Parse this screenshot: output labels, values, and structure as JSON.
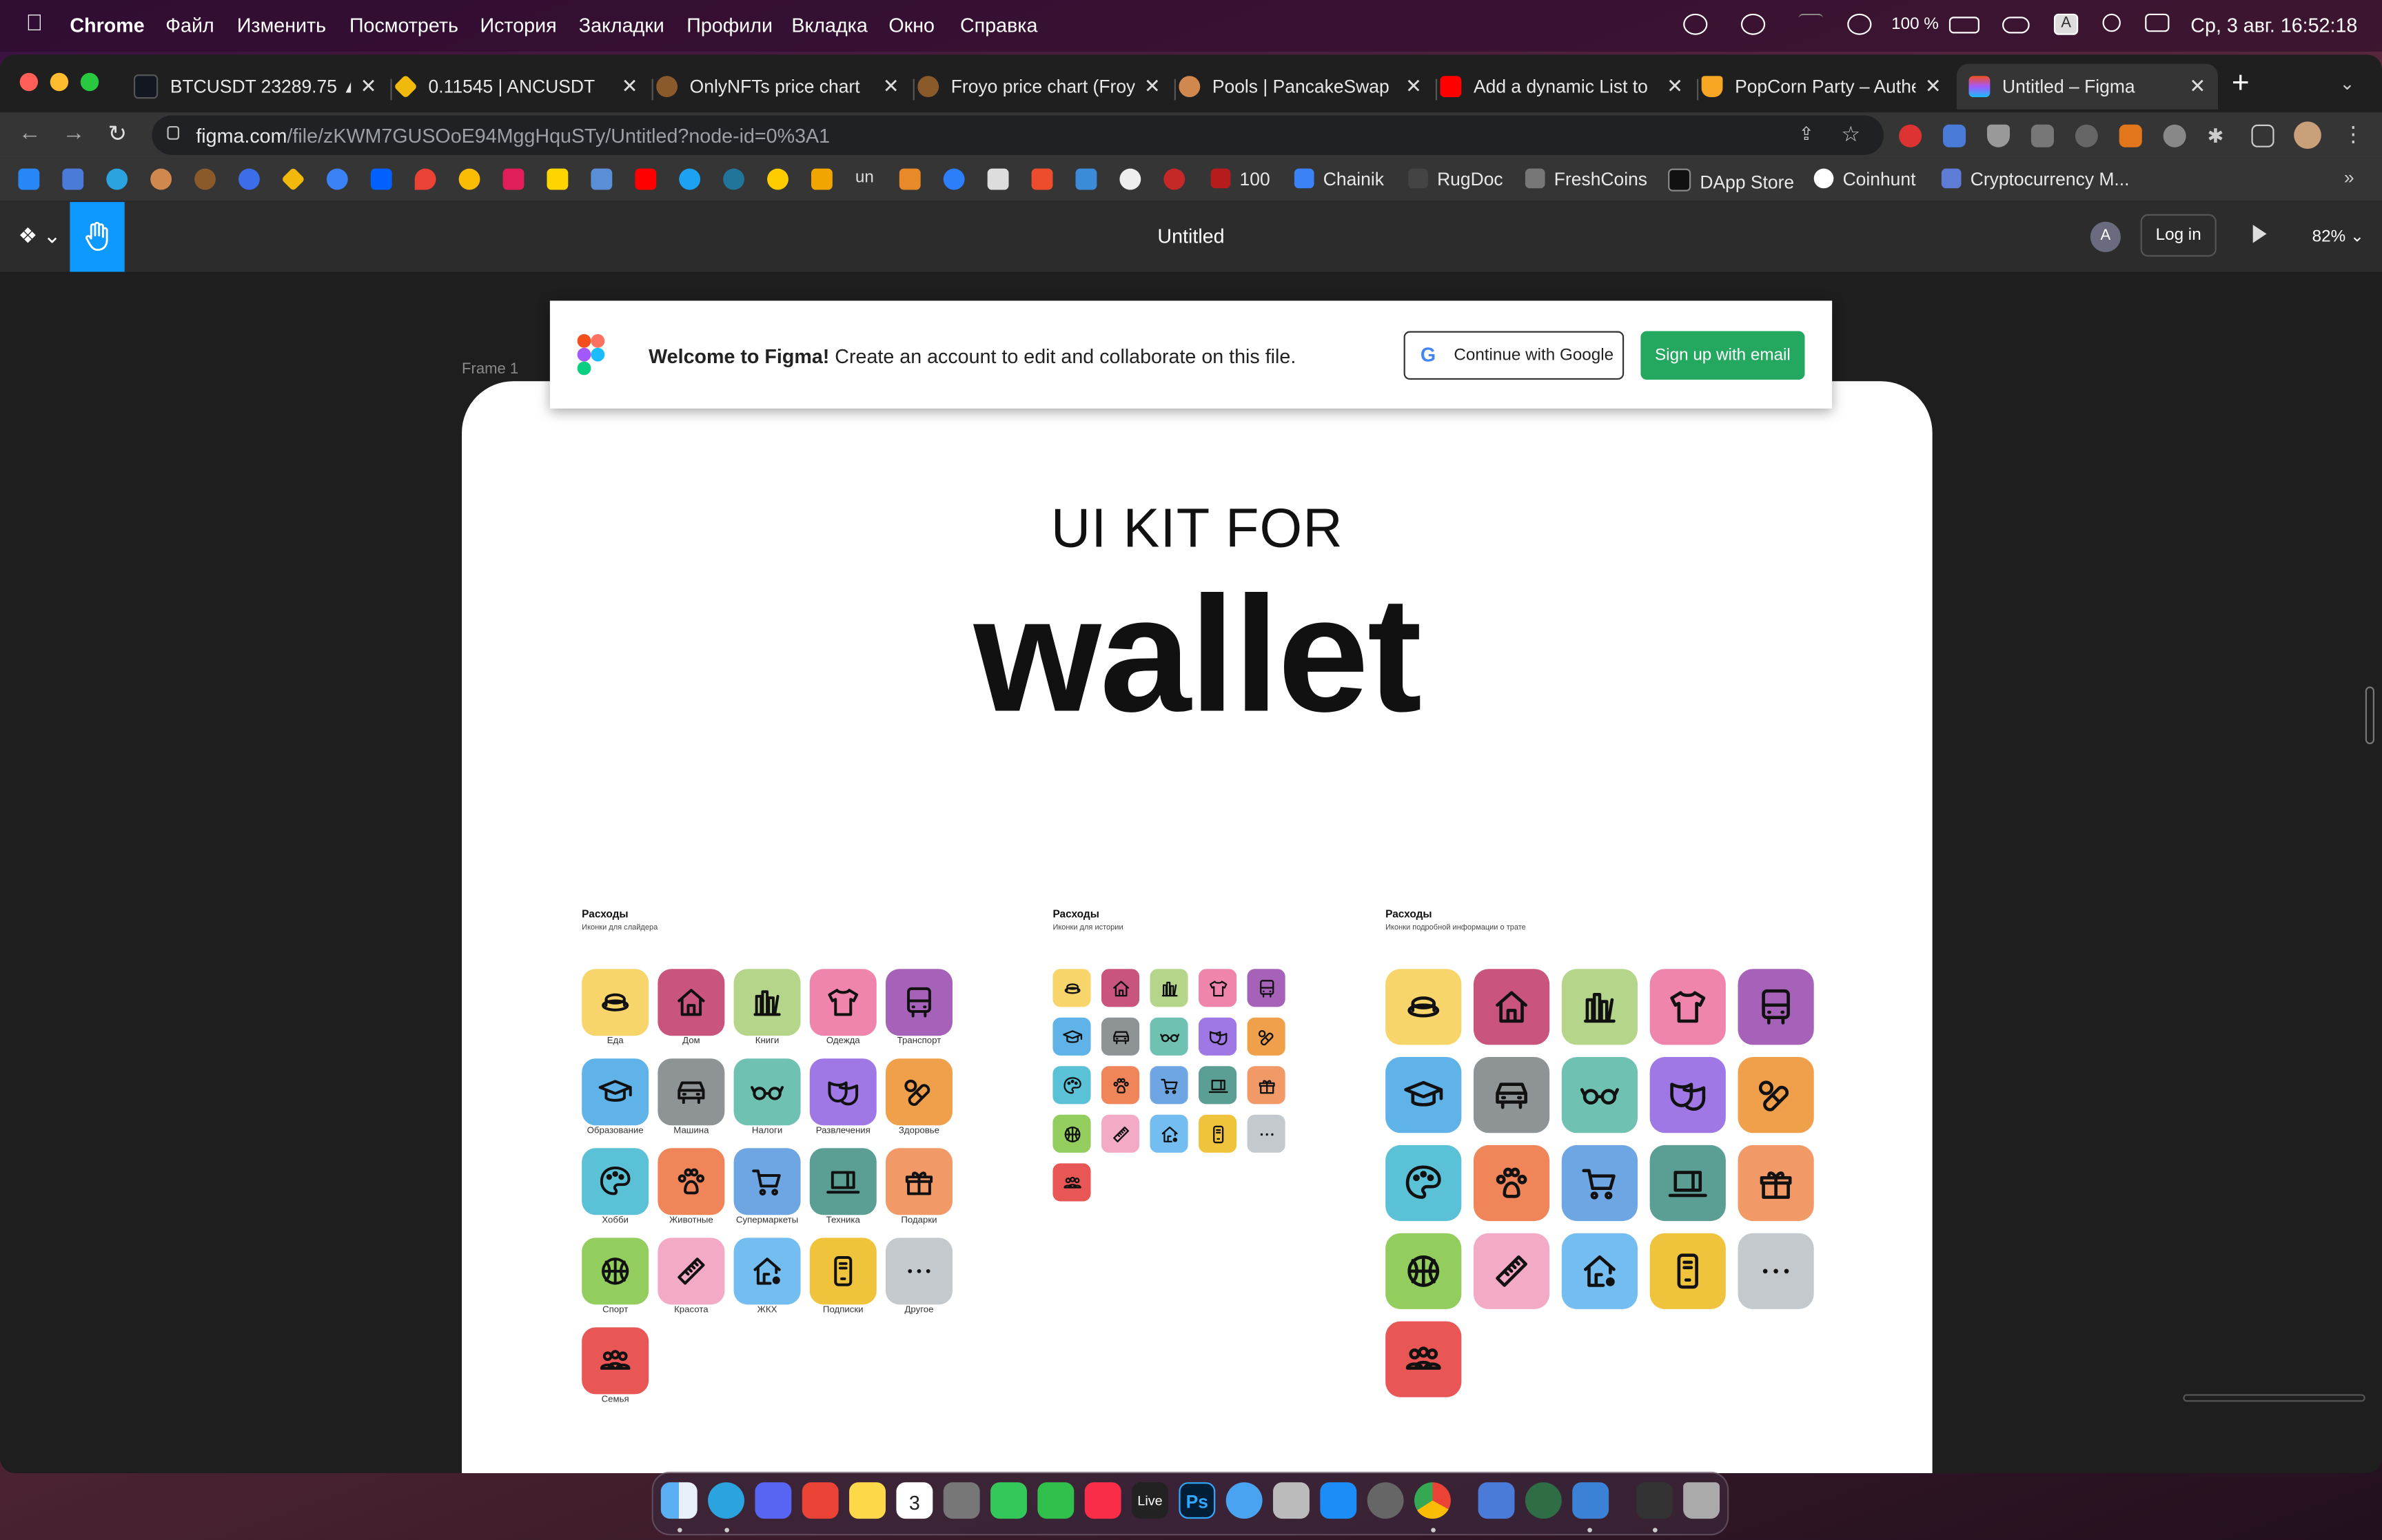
{
  "menubar": {
    "app": "Chrome",
    "items": [
      "Файл",
      "Изменить",
      "Посмотреть",
      "История",
      "Закладки",
      "Профили",
      "Вкладка",
      "Окно",
      "Справка"
    ],
    "battery": "100 %",
    "date_time": "Ср, 3 авг.  16:52:18"
  },
  "tabs": [
    {
      "title": "BTCUSDT 23289.75 ▲",
      "color": "#131722"
    },
    {
      "title": "0.11545  |  ANCUSDT",
      "color": "#f0b90b"
    },
    {
      "title": "OnlyNFTs price chart",
      "color": "#8b5a2b"
    },
    {
      "title": "Froyo price chart (Froyo)",
      "color": "#8b5a2b"
    },
    {
      "title": "Pools | PancakeSwap",
      "color": "#d1884f"
    },
    {
      "title": "Add a dynamic List to",
      "color": "#ff0000"
    },
    {
      "title": "PopCorn Party – Authentication",
      "color": "#f6a623"
    },
    {
      "title": "Untitled – Figma",
      "color": "#a259ff"
    }
  ],
  "address": {
    "host": "figma.com",
    "path": "/file/zKWM7GUSOoE94MggHquSTy/Untitled?node-id=0%3A1"
  },
  "bookmarks_text": [
    "100",
    "Chainik",
    "RugDoc",
    "FreshCoins",
    "DApp Store",
    "Coinhunt",
    "Cryptocurrency M..."
  ],
  "figma": {
    "title": "Untitled",
    "avatar": "A",
    "login": "Log in",
    "zoom": "82%",
    "frame_label": "Frame 1"
  },
  "welcome": {
    "bold": "Welcome to Figma!",
    "text": " Create an account to edit and collaborate on this file.",
    "google_btn": "Continue with Google",
    "email_btn": "Sign up with email"
  },
  "hero": {
    "line1": "UI KIT FOR",
    "line2": "wallet"
  },
  "groups": [
    {
      "title": "Расходы",
      "subtitle": "Иконки для слайдера"
    },
    {
      "title": "Расходы",
      "subtitle": "Иконки для истории"
    },
    {
      "title": "Расходы",
      "subtitle": "Иконки подробной информации о трате"
    }
  ],
  "categories": [
    {
      "label": "Еда",
      "color": "#f7d56b",
      "icon": "food-icon"
    },
    {
      "label": "Дом",
      "color": "#c9547e",
      "icon": "home-icon"
    },
    {
      "label": "Книги",
      "color": "#b5d68a",
      "icon": "books-icon"
    },
    {
      "label": "Одежда",
      "color": "#ef85ad",
      "icon": "tshirt-icon"
    },
    {
      "label": "Транспорт",
      "color": "#a562b8",
      "icon": "bus-icon"
    },
    {
      "label": "Образование",
      "color": "#5fb3e8",
      "icon": "graduation-cap-icon"
    },
    {
      "label": "Машина",
      "color": "#8e9396",
      "icon": "car-icon"
    },
    {
      "label": "Налоги",
      "color": "#6fc1b2",
      "icon": "glasses-icon"
    },
    {
      "label": "Развлечения",
      "color": "#9f78e6",
      "icon": "theater-masks-icon"
    },
    {
      "label": "Здоровье",
      "color": "#f0a04b",
      "icon": "pills-icon"
    },
    {
      "label": "Хобби",
      "color": "#5bc1d7",
      "icon": "palette-icon"
    },
    {
      "label": "Животные",
      "color": "#f0855a",
      "icon": "paw-icon"
    },
    {
      "label": "Супермаркеты",
      "color": "#6ea5e3",
      "icon": "cart-icon"
    },
    {
      "label": "Техника",
      "color": "#5b9e93",
      "icon": "laptop-icon"
    },
    {
      "label": "Подарки",
      "color": "#f19a68",
      "icon": "gift-icon"
    },
    {
      "label": "Спорт",
      "color": "#92cd5e",
      "icon": "ball-icon"
    },
    {
      "label": "Красота",
      "color": "#f3aac6",
      "icon": "comb-icon"
    },
    {
      "label": "ЖКХ",
      "color": "#73bdf0",
      "icon": "utilities-house-icon"
    },
    {
      "label": "Подписки",
      "color": "#f0c33c",
      "icon": "phone-icon"
    },
    {
      "label": "Другое",
      "color": "#c4c9ce",
      "icon": "more-icon"
    },
    {
      "label": "Семья",
      "color": "#e85656",
      "icon": "family-icon"
    }
  ]
}
